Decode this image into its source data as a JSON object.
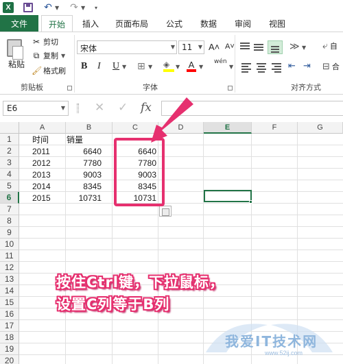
{
  "titlebar": {
    "excel_logo": "X",
    "icons": [
      "excel-logo-icon",
      "save-icon",
      "undo-icon",
      "redo-icon"
    ]
  },
  "tabs": {
    "file": "文件",
    "items": [
      "开始",
      "插入",
      "页面布局",
      "公式",
      "数据",
      "审阅",
      "视图"
    ],
    "active": "开始"
  },
  "ribbon": {
    "clipboard": {
      "paste": "粘贴",
      "cut": "剪切",
      "copy": "复制",
      "format_painter": "格式刷",
      "label": "剪贴板"
    },
    "font": {
      "name": "宋体",
      "size": "11",
      "label": "字体",
      "bold": "B",
      "italic": "I",
      "underline": "U",
      "font_color": "A",
      "phonetic": "wén"
    },
    "alignment": {
      "label": "对齐方式",
      "wrap_partial": "自",
      "merge_partial": "合"
    }
  },
  "formula_bar": {
    "name_box": "E6",
    "fx": "fx",
    "cancel": "✕",
    "confirm": "✓",
    "value": ""
  },
  "columns": [
    "A",
    "B",
    "C",
    "D",
    "E",
    "F",
    "G"
  ],
  "selected_column": "E",
  "rows": [
    "1",
    "2",
    "3",
    "4",
    "5",
    "6",
    "7",
    "8",
    "9",
    "10",
    "11",
    "12",
    "13",
    "14",
    "15",
    "16",
    "17",
    "18",
    "19",
    "20"
  ],
  "selected_row": "6",
  "table": {
    "header": [
      "时间",
      "销量"
    ],
    "data": [
      [
        "2011",
        "6640",
        "6640"
      ],
      [
        "2012",
        "7780",
        "7780"
      ],
      [
        "2013",
        "9003",
        "9003"
      ],
      [
        "2014",
        "8345",
        "8345"
      ],
      [
        "2015",
        "10731",
        "10731"
      ]
    ]
  },
  "annotation": {
    "line1": "按住Ctrl键，下拉鼠标，",
    "line2": "设置C列等于B列",
    "color": "#e6306f"
  },
  "watermark": {
    "text": "我爱IT技术网",
    "url": "www.52ij.com"
  },
  "colors": {
    "excel_green": "#217346",
    "annotation_pink": "#e6306f"
  }
}
